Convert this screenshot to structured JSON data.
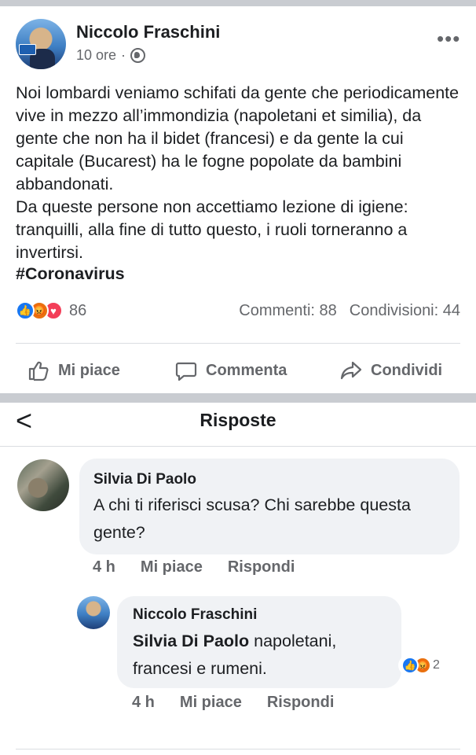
{
  "post": {
    "author": "Niccolo Fraschini",
    "time": "10 ore",
    "meta_sep": "·",
    "more": "•••",
    "paragraph1": "Noi lombardi veniamo schifati da gente che periodicamente vive in mezzo all’immondizia (napoletani et similia), da gente che non ha il bidet (francesi) e da gente la cui capitale (Bucarest) ha le fogne popolate da bambini abbandonati.",
    "paragraph2": "Da queste persone non accettiamo lezione di igiene: tranquilli, alla fine di tutto questo, i ruoli torneranno a invertirsi.",
    "hashtag": "#Coronavirus",
    "reaction_count": "86",
    "comments": "Commenti: 88",
    "shares": "Condivisioni: 44",
    "actions": {
      "like": "Mi piace",
      "comment": "Commenta",
      "share": "Condividi"
    }
  },
  "replies": {
    "back": "<",
    "title": "Risposte"
  },
  "comments": [
    {
      "author": "Silvia Di Paolo",
      "text": "A chi ti riferisci scusa? Chi sarebbe questa gente?",
      "time": "4 h",
      "like": "Mi piace",
      "reply": "Rispondi"
    },
    {
      "author": "Niccolo Fraschini",
      "mention": "Silvia Di Paolo",
      "text": " napoletani, francesi e rumeni.",
      "time": "4 h",
      "like": "Mi piace",
      "reply": "Rispondi",
      "reaction_count": "2"
    }
  ],
  "colors": {
    "like_blue": "#1877f2",
    "angry_orange": "#e9710f",
    "love_red": "#f33e58",
    "muted_text": "#65676b",
    "bubble_bg": "#f0f2f5"
  },
  "icons": {
    "like": "thumbs-up-icon",
    "comment": "comment-bubble-icon",
    "share": "share-arrow-icon",
    "privacy": "globe-icon",
    "back": "chevron-left-icon"
  }
}
